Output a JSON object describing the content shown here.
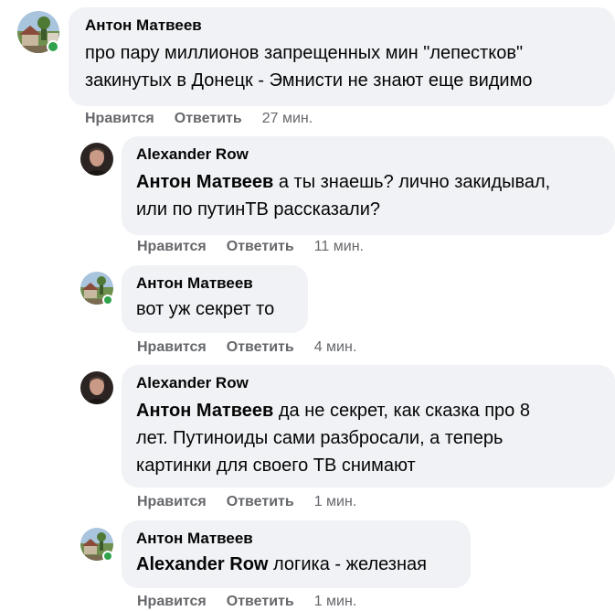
{
  "comments": [
    {
      "author": "Антон Матвеев",
      "mention": "",
      "text_lines": [
        "про пару миллионов запрещенных мин \"лепестков\"",
        "закинутых в Донецк - Эмнисти не знают еще видимо"
      ],
      "like_label": "Нравится",
      "reply_label": "Ответить",
      "time": "27 мин.",
      "avatar": "landscape-avatar",
      "online": true
    },
    {
      "author": "Alexander Row",
      "mention": "Антон Матвеев",
      "text_lines": [
        " а ты знаешь? лично закидывал,",
        "или по путинТВ рассказали?"
      ],
      "like_label": "Нравится",
      "reply_label": "Ответить",
      "time": "11 мин.",
      "avatar": "portrait-avatar",
      "online": false
    },
    {
      "author": "Антон Матвеев",
      "mention": "",
      "text_lines": [
        "вот уж секрет то"
      ],
      "like_label": "Нравится",
      "reply_label": "Ответить",
      "time": "4 мин.",
      "avatar": "landscape-avatar",
      "online": true
    },
    {
      "author": "Alexander Row",
      "mention": "Антон Матвеев",
      "text_lines": [
        " да не секрет, как сказка про 8",
        "лет. Путиноиды сами разбросали, а теперь",
        "картинки для своего ТВ снимают"
      ],
      "like_label": "Нравится",
      "reply_label": "Ответить",
      "time": "1 мин.",
      "avatar": "portrait-avatar",
      "online": false
    },
    {
      "author": "Антон Матвеев",
      "mention": "Alexander Row",
      "text_lines": [
        " логика - железная"
      ],
      "like_label": "Нравится",
      "reply_label": "Ответить",
      "time": "1 мин.",
      "avatar": "landscape-avatar",
      "online": true
    }
  ],
  "colors": {
    "bubble": "#f0f2f5",
    "secondary_text": "#65676b",
    "online": "#31a24c"
  }
}
